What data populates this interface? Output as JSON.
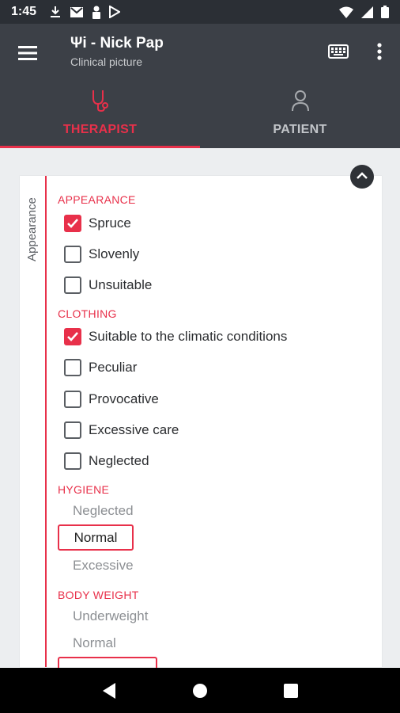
{
  "status_bar": {
    "time": "1:45",
    "left_icons": [
      "download-icon",
      "mail-icon",
      "lock-person-icon",
      "play-store-icon"
    ],
    "right_icons": [
      "wifi-icon",
      "signal-icon",
      "battery-icon"
    ]
  },
  "app_bar": {
    "title": "Ψi - Nick Pap",
    "subtitle": "Clinical picture",
    "icons": [
      "menu-icon",
      "keyboard-icon",
      "more-vert-icon"
    ]
  },
  "tabs": [
    {
      "label": "THERAPIST",
      "icon": "stethoscope-icon",
      "active": true
    },
    {
      "label": "PATIENT",
      "icon": "person-icon",
      "active": false
    }
  ],
  "card": {
    "side_label": "Appearance",
    "sections": {
      "appearance": {
        "title": "APPEARANCE",
        "items": [
          {
            "label": "Spruce",
            "checked": true
          },
          {
            "label": "Slovenly",
            "checked": false
          },
          {
            "label": "Unsuitable",
            "checked": false
          }
        ]
      },
      "clothing": {
        "title": "CLOTHING",
        "items": [
          {
            "label": "Suitable to the climatic conditions",
            "checked": true
          },
          {
            "label": "Peculiar",
            "checked": false
          },
          {
            "label": "Provocative",
            "checked": false
          },
          {
            "label": "Excessive care",
            "checked": false
          },
          {
            "label": "Neglected",
            "checked": false
          }
        ]
      },
      "hygiene": {
        "title": "HYGIENE",
        "options": [
          "Neglected",
          "Normal",
          "Excessive"
        ],
        "selected": "Normal"
      },
      "body_weight": {
        "title": "BODY WEIGHT",
        "options": [
          "Underweight",
          "Normal"
        ]
      }
    }
  },
  "colors": {
    "accent": "#e8304a",
    "app_bar": "#3c4047",
    "status_bar": "#2b2f35",
    "background": "#eceef0"
  },
  "nav_bar": {
    "buttons": [
      "back-icon",
      "home-icon",
      "recents-icon"
    ]
  }
}
